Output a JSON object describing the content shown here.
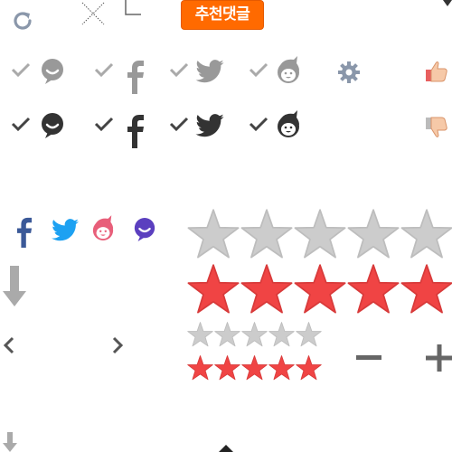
{
  "badge": {
    "label": "추천댓글",
    "color": "#ff6a00"
  },
  "colors": {
    "gray_light": "#aaaaaa",
    "gray_dark": "#555555",
    "facebook": "#3b5998",
    "twitter": "#1da1f2",
    "pink": "#e85f7a",
    "purple": "#5b3fbf",
    "star_empty": "#cccccc",
    "star_filled": "#f04444"
  },
  "icons": {
    "refresh": "refresh-icon",
    "close": "close-icon",
    "corner": "corner-bracket-icon",
    "settings": "gear-icon",
    "thumbs_up": "thumbs-up-icon",
    "thumbs_down": "thumbs-down-icon",
    "arrow_down": "arrow-down-icon",
    "chevron_left": "chevron-left-icon",
    "chevron_right": "chevron-right-icon",
    "minus": "minus-icon",
    "plus": "plus-icon"
  },
  "social_rows": [
    {
      "state": "unselected",
      "items": [
        "talk",
        "facebook",
        "twitter",
        "person"
      ]
    },
    {
      "state": "selected",
      "items": [
        "talk",
        "facebook",
        "twitter",
        "person"
      ]
    }
  ],
  "ratings": {
    "large_empty_count": 5,
    "large_filled_count": 5,
    "small_empty_count": 5,
    "small_filled_count": 5
  }
}
